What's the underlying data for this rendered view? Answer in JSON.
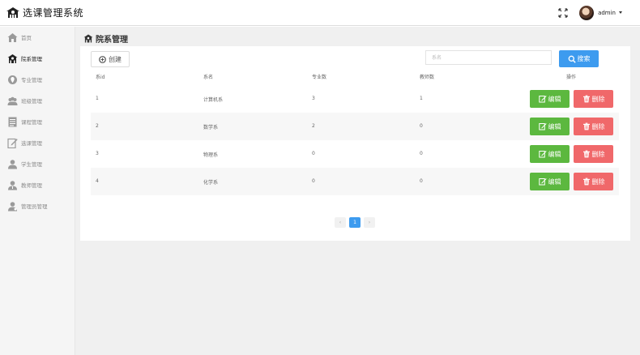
{
  "app": {
    "title": "选课管理系统"
  },
  "user": {
    "name": "admin"
  },
  "sidebar": {
    "items": [
      {
        "label": "首页",
        "icon": "home-icon"
      },
      {
        "label": "院系管理",
        "icon": "building-icon",
        "active": true
      },
      {
        "label": "专业管理",
        "icon": "major-icon"
      },
      {
        "label": "班级管理",
        "icon": "class-group-icon"
      },
      {
        "label": "课程管理",
        "icon": "course-list-icon"
      },
      {
        "label": "选课管理",
        "icon": "course-select-icon"
      },
      {
        "label": "学生管理",
        "icon": "student-icon"
      },
      {
        "label": "教师管理",
        "icon": "teacher-icon"
      },
      {
        "label": "管理员管理",
        "icon": "admin-icon"
      }
    ]
  },
  "page": {
    "title": "院系管理"
  },
  "toolbar": {
    "create_label": "创建",
    "search_placeholder": "系名",
    "search_label": "搜索"
  },
  "table": {
    "headers": [
      "系id",
      "系名",
      "专业数",
      "教师数",
      "操作"
    ],
    "rows": [
      {
        "id": "1",
        "name": "计算机系",
        "majors": "3",
        "teachers": "1"
      },
      {
        "id": "2",
        "name": "数学系",
        "majors": "2",
        "teachers": "0"
      },
      {
        "id": "3",
        "name": "物理系",
        "majors": "0",
        "teachers": "0"
      },
      {
        "id": "4",
        "name": "化学系",
        "majors": "0",
        "teachers": "0"
      }
    ],
    "edit_label": "编辑",
    "delete_label": "删除"
  },
  "pagination": {
    "prev": "‹",
    "current": "1",
    "next": "›"
  },
  "colors": {
    "primary": "#3d9bef",
    "success": "#5cb83f",
    "danger": "#f0686a",
    "sidebar_bg": "#f5f5f5",
    "main_bg": "#f0f0f0"
  }
}
